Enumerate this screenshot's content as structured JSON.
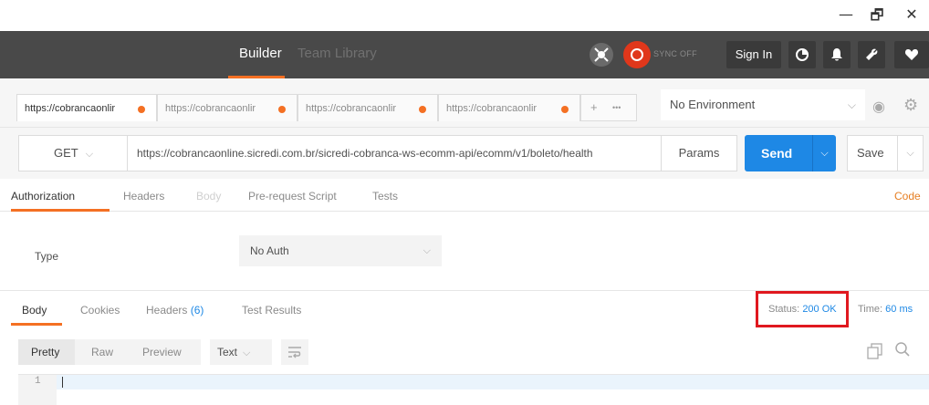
{
  "window": {
    "minimize": "—",
    "maximize": "🗗",
    "close": "✕"
  },
  "header": {
    "builder_label": "Builder",
    "team_library_label": "Team Library",
    "sync_label": "SYNC OFF",
    "sign_in_label": "Sign In",
    "accent_color": "#f47023"
  },
  "request_tabs": [
    {
      "label": "https://cobrancaonlir",
      "active": true
    },
    {
      "label": "https://cobrancaonlir",
      "active": false
    },
    {
      "label": "https://cobrancaonlir",
      "active": false
    },
    {
      "label": "https://cobrancaonlir",
      "active": false
    }
  ],
  "tab_actions": {
    "add": "+",
    "more": "•••"
  },
  "environment": {
    "selected": "No Environment",
    "chevron": "⌵"
  },
  "request": {
    "method": "GET",
    "url": "https://cobrancaonline.sicredi.com.br/sicredi-cobranca-ws-ecomm-api/ecomm/v1/boleto/health",
    "params_label": "Params",
    "send_label": "Send",
    "save_label": "Save",
    "send_color": "#1e88e5"
  },
  "request_subtabs": {
    "authorization": "Authorization",
    "headers": "Headers",
    "body": "Body",
    "prerequest": "Pre-request Script",
    "tests": "Tests",
    "code": "Code"
  },
  "auth": {
    "type_label": "Type",
    "selected": "No Auth"
  },
  "response_tabs": {
    "body": "Body",
    "cookies": "Cookies",
    "headers": "Headers",
    "headers_count": "(6)",
    "test_results": "Test Results"
  },
  "response_status": {
    "status_label": "Status:",
    "status_value": "200 OK",
    "time_label": "Time:",
    "time_value": "60 ms",
    "highlight_color": "#e0181f"
  },
  "response_toolbar": {
    "pretty": "Pretty",
    "raw": "Raw",
    "preview": "Preview",
    "format": "Text"
  },
  "editor": {
    "line_number": "1"
  },
  "icons": {
    "interceptor": "satellite-icon",
    "sync": "sync-icon",
    "runner": "runner-icon",
    "bell": "bell-icon",
    "wrench": "wrench-icon",
    "heart": "heart-icon",
    "eye": "eye-icon",
    "gear": "gear-icon",
    "wrap": "wrap-lines-icon",
    "copy": "copy-icon",
    "search": "search-icon"
  }
}
